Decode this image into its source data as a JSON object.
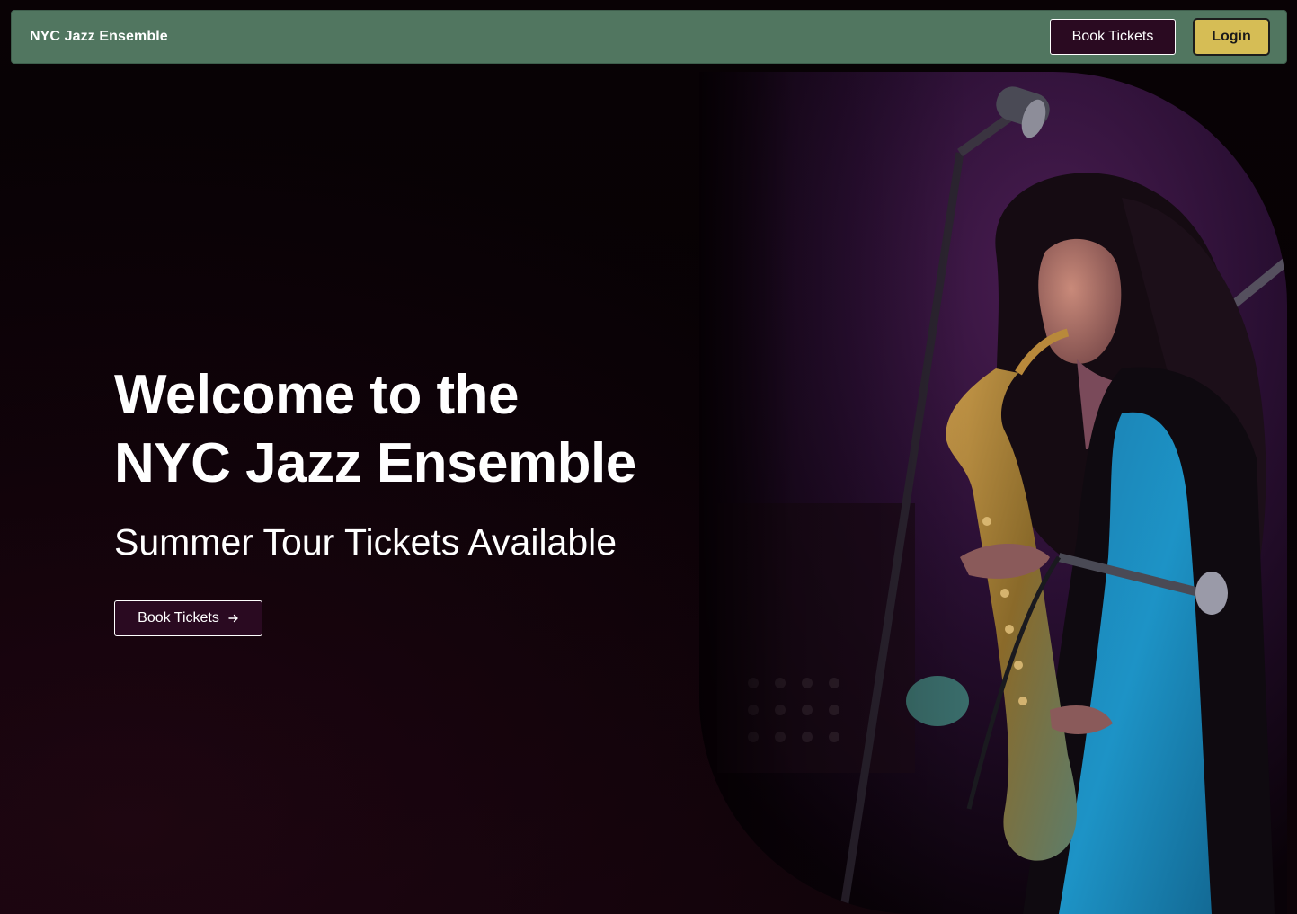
{
  "header": {
    "brand": "NYC Jazz Ensemble",
    "book_label": "Book Tickets",
    "login_label": "Login"
  },
  "hero": {
    "title_line1": "Welcome to the",
    "title_line2": "NYC Jazz Ensemble",
    "subtitle": "Summer Tour Tickets Available",
    "cta_label": "Book Tickets",
    "cta_icon": "arrow-right-icon",
    "image": "saxophonist-performing-photo"
  },
  "colors": {
    "header_bg": "#517660",
    "primary_button_bg": "#2a0a21",
    "login_button_bg": "#d6bd55",
    "page_bg": "#090205"
  }
}
